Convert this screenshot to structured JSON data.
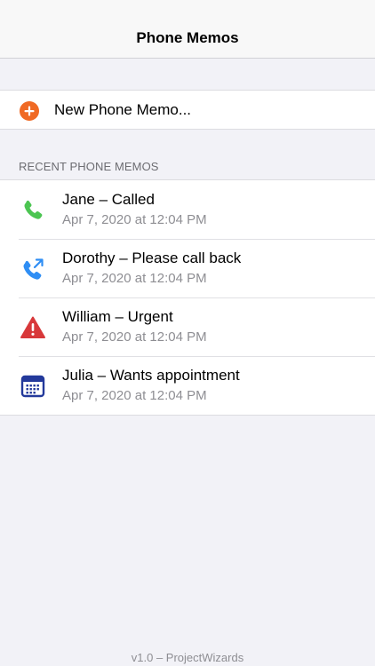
{
  "nav": {
    "title": "Phone Memos"
  },
  "new_memo": {
    "label": "New Phone Memo...",
    "icon": "plus-circle-icon",
    "icon_color": "#f06a24"
  },
  "section": {
    "header": "RECENT PHONE MEMOS"
  },
  "memos": [
    {
      "title": "Jane – Called",
      "time": "Apr 7, 2020 at 12:04 PM",
      "icon": "phone-icon",
      "icon_color": "#4cc552"
    },
    {
      "title": "Dorothy – Please call back",
      "time": "Apr 7, 2020 at 12:04 PM",
      "icon": "phone-callback-icon",
      "icon_color": "#2f8ef4"
    },
    {
      "title": "William – Urgent",
      "time": "Apr 7, 2020 at 12:04 PM",
      "icon": "warning-icon",
      "icon_color": "#d8383a"
    },
    {
      "title": "Julia – Wants appointment",
      "time": "Apr 7, 2020 at 12:04 PM",
      "icon": "calendar-icon",
      "icon_color": "#23399b"
    }
  ],
  "footer": {
    "text": "v1.0 – ProjectWizards"
  }
}
